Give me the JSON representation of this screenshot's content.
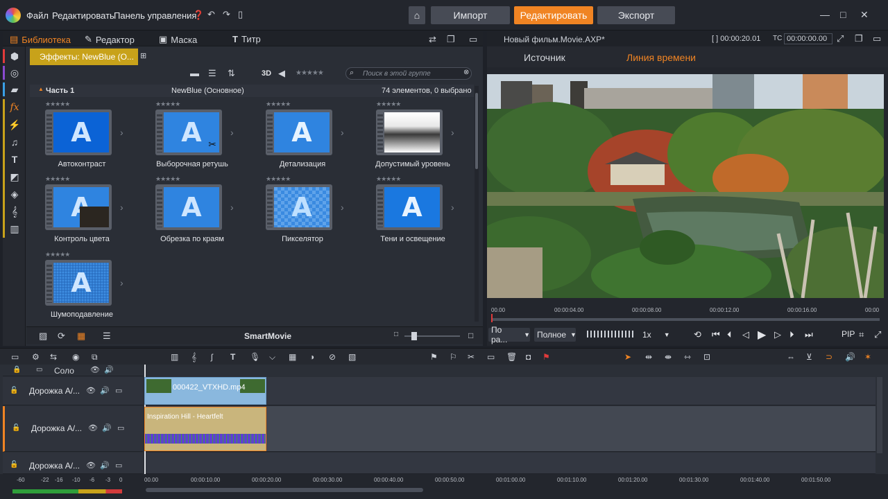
{
  "topbar": {
    "menu": [
      "Файл",
      "Редактировать",
      "Панель управления"
    ],
    "buttons": {
      "import": "Импорт",
      "edit": "Редактировать",
      "export": "Экспорт"
    },
    "window": {
      "minimize": "—",
      "maximize": "□",
      "close": "✕"
    }
  },
  "library": {
    "tabs": [
      "Библиотека",
      "Редактор",
      "Маска",
      "Титр"
    ],
    "group_tab": "Эффекты: NewBlue (O...",
    "toolbar": {
      "three_d": "3D",
      "stars": "★★★★★"
    },
    "search": {
      "placeholder": "Поиск в этой группе"
    },
    "section": {
      "part": "Часть 1",
      "collection": "NewBlue (Основное)",
      "count": "74 элементов, 0 выбрано"
    },
    "effects": [
      {
        "label": "Автоконтраст",
        "stars": "★★★★★"
      },
      {
        "label": "Выборочная ретушь",
        "stars": "★★★★★"
      },
      {
        "label": "Детализация",
        "stars": "★★★★★"
      },
      {
        "label": "Допустимый уровень",
        "stars": "★★★★★"
      },
      {
        "label": "Контроль цвета",
        "stars": "★★★★★"
      },
      {
        "label": "Обрезка по краям",
        "stars": "★★★★★"
      },
      {
        "label": "Пикселятор",
        "stars": "★★★★★"
      },
      {
        "label": "Тени и освещение",
        "stars": "★★★★★"
      },
      {
        "label": "Шумоподавление",
        "stars": "★★★★★"
      }
    ],
    "bottom": {
      "title": "SmartMovie"
    }
  },
  "player": {
    "title": "Новый фильм.Movie.AXP*",
    "timecode": "00:00:20.01",
    "tc_label": "TC",
    "tc_value": "00:00:00.00",
    "tabs": {
      "source": "Источник",
      "timeline": "Линия времени"
    },
    "ruler": [
      "00.00",
      "00:00:04.00",
      "00:00:08.00",
      "00:00:12.00",
      "00:00:16.00",
      "00:00"
    ],
    "controls": {
      "fit": "По ра...",
      "quality": "Полное",
      "speed": "1x",
      "pip": "PIP"
    }
  },
  "timeline": {
    "solo_label": "Соло",
    "tracks": [
      {
        "name": "Дорожка A/..."
      },
      {
        "name": "Дорожка A/..."
      },
      {
        "name": "Дорожка A/..."
      }
    ],
    "clips": {
      "video": "000422_VTXHD.mp4",
      "audio": "Inspiration Hill - Heartfelt"
    },
    "ruler": [
      "00.00",
      "00:00:10.00",
      "00:00:20.00",
      "00:00:30.00",
      "00:00:40.00",
      "00:00:50.00",
      "00:01:00.00",
      "00:01:10.00",
      "00:01:20.00",
      "00:01:30.00",
      "00:01:40.00",
      "00:01:50.00"
    ],
    "meter_labels": [
      "-60",
      "-22",
      "-16",
      "-10",
      "-6",
      "-3",
      "0"
    ]
  },
  "colors": {
    "accent": "#f08423",
    "group_tab": "#c8a21a",
    "effect_blue": "#2f84e0"
  }
}
